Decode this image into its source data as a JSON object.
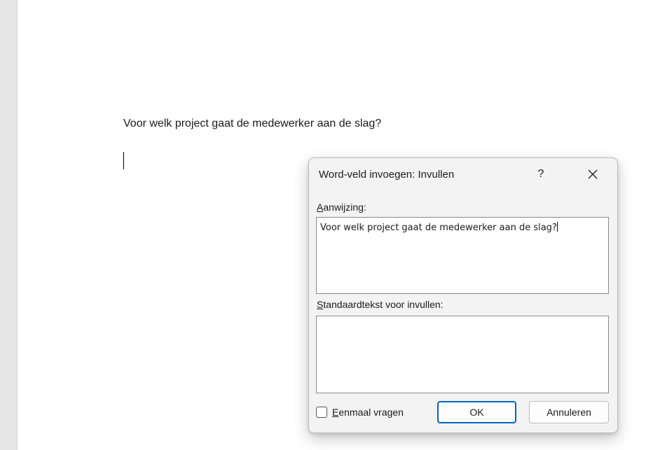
{
  "document": {
    "paragraph_text": "Voor welk project gaat de medewerker aan de slag?"
  },
  "dialog": {
    "title": "Word-veld invoegen: Invullen",
    "help_label": "?",
    "close_icon": "close-icon",
    "prompt": {
      "label_accel": "A",
      "label_rest": "anwijzing:",
      "value": "Voor welk project gaat de medewerker aan de slag?"
    },
    "default_text": {
      "label_accel": "S",
      "label_rest": "tandaardtekst voor invullen:",
      "value": ""
    },
    "ask_once": {
      "label_accel": "E",
      "label_rest": "enmaal vragen",
      "checked": false
    },
    "ok_label": "OK",
    "cancel_label": "Annuleren"
  },
  "colors": {
    "dialog_background": "#f3f3f3",
    "ok_border_accent": "#0067c0",
    "gutter": "#e6e6e6"
  }
}
